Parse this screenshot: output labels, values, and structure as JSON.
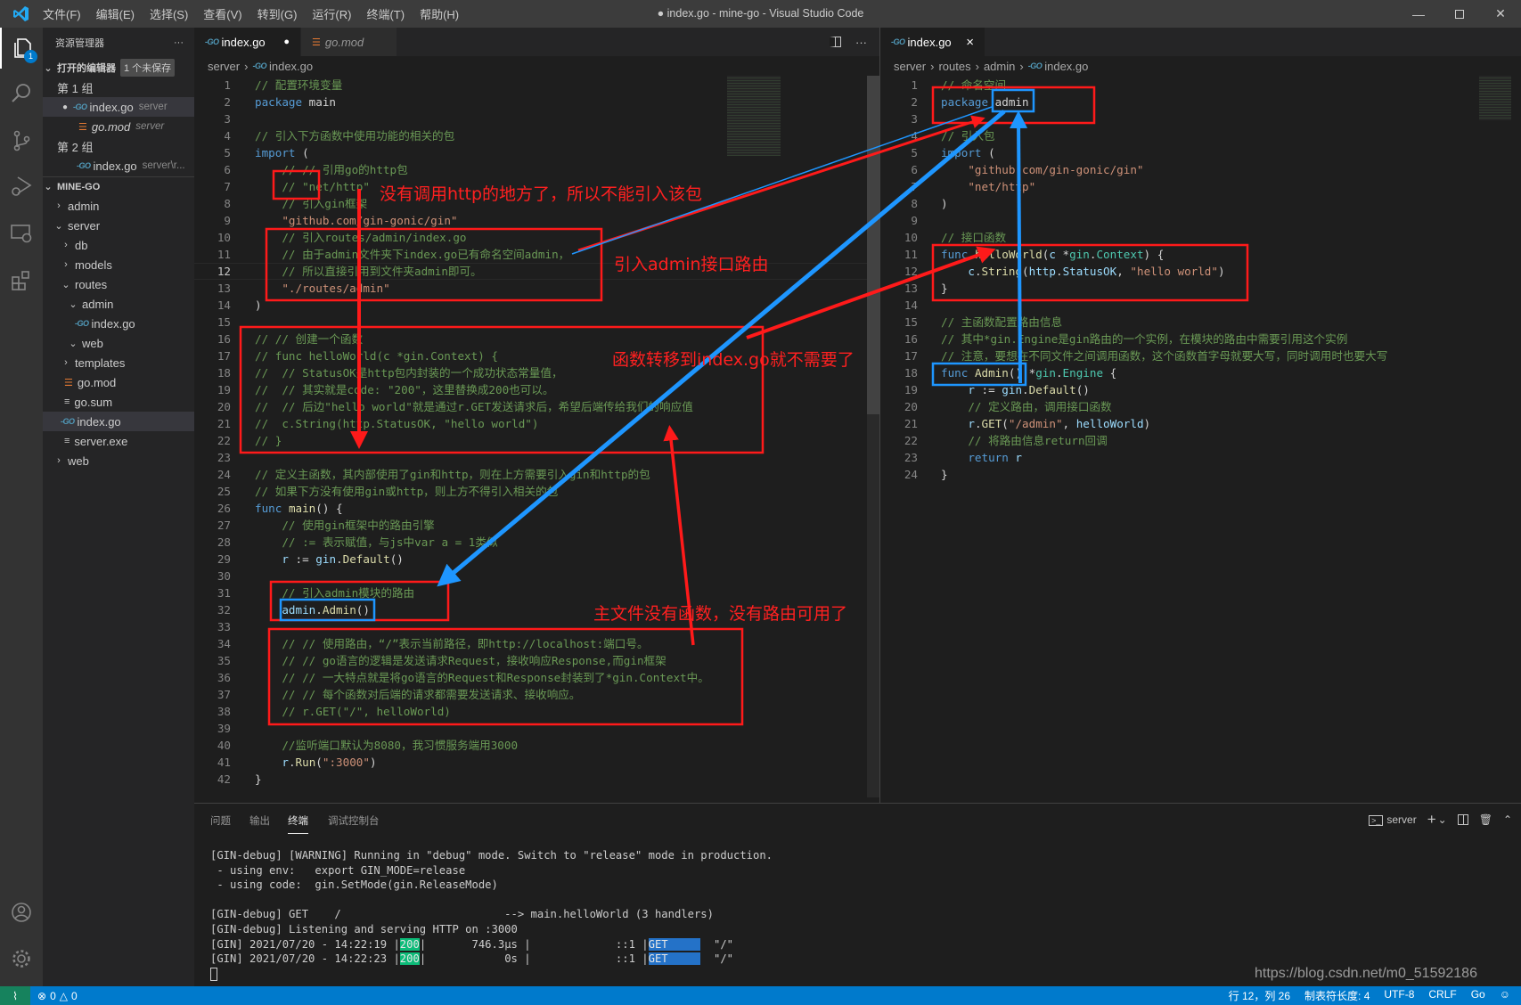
{
  "titlebar": {
    "title": "● index.go - mine-go - Visual Studio Code",
    "menu": [
      "文件(F)",
      "编辑(E)",
      "选择(S)",
      "查看(V)",
      "转到(G)",
      "运行(R)",
      "终端(T)",
      "帮助(H)"
    ]
  },
  "activity": {
    "explorer_badge": "1"
  },
  "sidebar": {
    "title": "资源管理器",
    "more": "···",
    "open_editors": "打开的编辑器",
    "unsaved_badge": "1 个未保存",
    "group1": "第 1 组",
    "group1_items": [
      {
        "name": "index.go",
        "desc": "server"
      },
      {
        "name": "go.mod",
        "desc": "server"
      }
    ],
    "group2": "第 2 组",
    "group2_items": [
      {
        "name": "index.go",
        "desc": "server\\r..."
      }
    ],
    "project": "MINE-GO",
    "tree": [
      "admin",
      "server",
      "db",
      "models",
      "routes",
      "admin",
      "index.go",
      "web",
      "templates",
      "go.mod",
      "go.sum",
      "index.go",
      "server.exe",
      "web"
    ]
  },
  "left_editor": {
    "tabs": [
      {
        "label": "index.go",
        "dirty": "●"
      },
      {
        "label": "go.mod"
      }
    ],
    "breadcrumb": [
      "server",
      "index.go"
    ],
    "current_line": 12,
    "lines": [
      [
        [
          "// 配置环境变量",
          "c"
        ]
      ],
      [
        [
          "package",
          "k"
        ],
        [
          " main",
          "p"
        ]
      ],
      [],
      [
        [
          "// 引入下方函数中使用功能的相关的包",
          "c"
        ]
      ],
      [
        [
          "import",
          "k"
        ],
        [
          " (",
          "p"
        ]
      ],
      [
        [
          "    // // 引用go的http包",
          "c"
        ]
      ],
      [
        [
          "    // \"net/http\"",
          "c"
        ]
      ],
      [
        [
          "    // 引入gin框架",
          "c"
        ]
      ],
      [
        [
          "    ",
          "p"
        ],
        [
          "\"github.com/gin-gonic/gin\"",
          "s"
        ]
      ],
      [
        [
          "    // 引入routes/admin/index.go",
          "c"
        ]
      ],
      [
        [
          "    // 由于admin文件夹下index.go已有命名空间admin，",
          "c"
        ]
      ],
      [
        [
          "    // 所以直接引用到文件夹admin即可。",
          "c"
        ]
      ],
      [
        [
          "    ",
          "p"
        ],
        [
          "\"./routes/admin\"",
          "s"
        ]
      ],
      [
        [
          ")",
          "p"
        ]
      ],
      [],
      [
        [
          "// // 创建一个函数",
          "c"
        ]
      ],
      [
        [
          "// func helloWorld(c *gin.Context) {",
          "c"
        ]
      ],
      [
        [
          "//  // StatusOK是http包内封装的一个成功状态常量值，",
          "c"
        ]
      ],
      [
        [
          "//  // 其实就是code: \"200\"，这里替换成200也可以。",
          "c"
        ]
      ],
      [
        [
          "//  // 后边\"hello world\"就是通过r.GET发送请求后，希望后端传给我们的响应值",
          "c"
        ]
      ],
      [
        [
          "//  c.String(http.StatusOK, \"hello world\")",
          "c"
        ]
      ],
      [
        [
          "// }",
          "c"
        ]
      ],
      [],
      [
        [
          "// 定义主函数，其内部使用了gin和http，则在上方需要引入gin和http的包",
          "c"
        ]
      ],
      [
        [
          "// 如果下方没有使用gin或http，则上方不得引入相关的包",
          "c"
        ]
      ],
      [
        [
          "func",
          "k"
        ],
        [
          " ",
          "p"
        ],
        [
          "main",
          "f"
        ],
        [
          "() {",
          "p"
        ]
      ],
      [
        [
          "    // 使用gin框架中的路由引擎",
          "c"
        ]
      ],
      [
        [
          "    // := 表示赋值，与js中var a = 1类似",
          "c"
        ]
      ],
      [
        [
          "    ",
          "p"
        ],
        [
          "r",
          "v"
        ],
        [
          " := ",
          "p"
        ],
        [
          "gin",
          "v"
        ],
        [
          ".",
          "p"
        ],
        [
          "Default",
          "f"
        ],
        [
          "()",
          "p"
        ]
      ],
      [],
      [
        [
          "    // 引入admin模块的路由",
          "c"
        ]
      ],
      [
        [
          "    ",
          "p"
        ],
        [
          "admin",
          "v"
        ],
        [
          ".",
          "p"
        ],
        [
          "Admin",
          "f"
        ],
        [
          "()",
          "p"
        ]
      ],
      [],
      [
        [
          "    // // 使用路由，“/”表示当前路径，即http://localhost:端口号。",
          "c"
        ]
      ],
      [
        [
          "    // // go语言的逻辑是发送请求Request，接收响应Response,而gin框架",
          "c"
        ]
      ],
      [
        [
          "    // // 一大特点就是将go语言的Request和Response封装到了*gin.Context中。",
          "c"
        ]
      ],
      [
        [
          "    // // 每个函数对后端的请求都需要发送请求、接收响应。",
          "c"
        ]
      ],
      [
        [
          "    // r.GET(\"/\", helloWorld)",
          "c"
        ]
      ],
      [],
      [
        [
          "    //监听端口默认为8080，我习惯服务端用3000",
          "c"
        ]
      ],
      [
        [
          "    ",
          "p"
        ],
        [
          "r",
          "v"
        ],
        [
          ".",
          "p"
        ],
        [
          "Run",
          "f"
        ],
        [
          "(",
          "p"
        ],
        [
          "\":3000\"",
          "s"
        ],
        [
          ")",
          "p"
        ]
      ],
      [
        [
          "}",
          "p"
        ]
      ]
    ]
  },
  "right_editor": {
    "tabs": [
      {
        "label": "index.go",
        "close": "×"
      }
    ],
    "breadcrumb": [
      "server",
      "routes",
      "admin",
      "index.go"
    ],
    "lines": [
      [
        [
          "// 命名空间",
          "c"
        ]
      ],
      [
        [
          "package",
          "k"
        ],
        [
          " admin",
          "p"
        ]
      ],
      [],
      [
        [
          "// 引入包",
          "c"
        ]
      ],
      [
        [
          "import",
          "k"
        ],
        [
          " (",
          "p"
        ]
      ],
      [
        [
          "    ",
          "p"
        ],
        [
          "\"github.com/gin-gonic/gin\"",
          "s"
        ]
      ],
      [
        [
          "    ",
          "p"
        ],
        [
          "\"net/http\"",
          "s"
        ]
      ],
      [
        [
          ")",
          "p"
        ]
      ],
      [],
      [
        [
          "// 接口函数",
          "c"
        ]
      ],
      [
        [
          "func",
          "k"
        ],
        [
          " ",
          "p"
        ],
        [
          "helloWorld",
          "f"
        ],
        [
          "(",
          "p"
        ],
        [
          "c",
          "v"
        ],
        [
          " *",
          "p"
        ],
        [
          "gin",
          "t"
        ],
        [
          ".",
          "p"
        ],
        [
          "Context",
          "t"
        ],
        [
          ") {",
          "p"
        ]
      ],
      [
        [
          "    ",
          "p"
        ],
        [
          "c",
          "v"
        ],
        [
          ".",
          "p"
        ],
        [
          "String",
          "f"
        ],
        [
          "(",
          "p"
        ],
        [
          "http",
          "v"
        ],
        [
          ".",
          "p"
        ],
        [
          "StatusOK",
          "v"
        ],
        [
          ", ",
          "p"
        ],
        [
          "\"hello world\"",
          "s"
        ],
        [
          ")",
          "p"
        ]
      ],
      [
        [
          "}",
          "p"
        ]
      ],
      [],
      [
        [
          "// 主函数配置路由信息",
          "c"
        ]
      ],
      [
        [
          "// 其中*gin.Engine是gin路由的一个实例，在模块的路由中需要引用这个实例",
          "c"
        ]
      ],
      [
        [
          "// 注意，要想在不同文件之间调用函数，这个函数首字母就要大写，同时调用时也要大写",
          "c"
        ]
      ],
      [
        [
          "func",
          "k"
        ],
        [
          " ",
          "p"
        ],
        [
          "Admin",
          "f"
        ],
        [
          "() *",
          "p"
        ],
        [
          "gin",
          "t"
        ],
        [
          ".",
          "p"
        ],
        [
          "Engine",
          "t"
        ],
        [
          " {",
          "p"
        ]
      ],
      [
        [
          "    ",
          "p"
        ],
        [
          "r",
          "v"
        ],
        [
          " := ",
          "p"
        ],
        [
          "gin",
          "v"
        ],
        [
          ".",
          "p"
        ],
        [
          "Default",
          "f"
        ],
        [
          "()",
          "p"
        ]
      ],
      [
        [
          "    // 定义路由，调用接口函数",
          "c"
        ]
      ],
      [
        [
          "    ",
          "p"
        ],
        [
          "r",
          "v"
        ],
        [
          ".",
          "p"
        ],
        [
          "GET",
          "f"
        ],
        [
          "(",
          "p"
        ],
        [
          "\"/admin\"",
          "s"
        ],
        [
          ", ",
          "p"
        ],
        [
          "helloWorld",
          "v"
        ],
        [
          ")",
          "p"
        ]
      ],
      [
        [
          "    // 将路由信息return回调",
          "c"
        ]
      ],
      [
        [
          "    ",
          "p"
        ],
        [
          "return",
          "k"
        ],
        [
          " r",
          "v"
        ]
      ],
      [
        [
          "}",
          "p"
        ]
      ]
    ]
  },
  "annotations": {
    "http_note": "没有调用http的地方了，所以不能引入该包",
    "import_admin_note": "引入admin接口路由",
    "moved_note": "函数转移到index.go就不需要了",
    "no_route_note": "主文件没有函数，没有路由可用了",
    "red": "#ff1a1a",
    "blue": "#1e96ff"
  },
  "panel": {
    "tabs": [
      "问题",
      "输出",
      "终端",
      "调试控制台"
    ],
    "active_tab": "终端",
    "terminal_name": "server",
    "terminal": {
      "warning": "[GIN-debug] [WARNING] Running in \"debug\" mode. Switch to \"release\" mode in production.",
      "env": " - using env:   export GIN_MODE=release",
      "code": " - using code:  gin.SetMode(gin.ReleaseMode)",
      "route": "[GIN-debug] GET    /                         --> main.helloWorld (3 handlers)",
      "listen": "[GIN-debug] Listening and serving HTTP on :3000",
      "requests": [
        {
          "prefix": "[GIN] 2021/07/20 - 14:22:19 |",
          "status": "200",
          "mid": "|       746.3µs |             ::1 |",
          "method": "GET     ",
          "path": "  \"/\""
        },
        {
          "prefix": "[GIN] 2021/07/20 - 14:22:23 |",
          "status": "200",
          "mid": "|            0s |             ::1 |",
          "method": "GET     ",
          "path": "  \"/\""
        }
      ]
    }
  },
  "status": {
    "errors": "0",
    "warnings": "0",
    "position": "行 12，列 26",
    "tab_size": "制表符长度: 4",
    "encoding": "UTF-8",
    "eol": "CRLF",
    "language": "Go",
    "watermark": "https://blog.csdn.net/m0_51592186"
  }
}
